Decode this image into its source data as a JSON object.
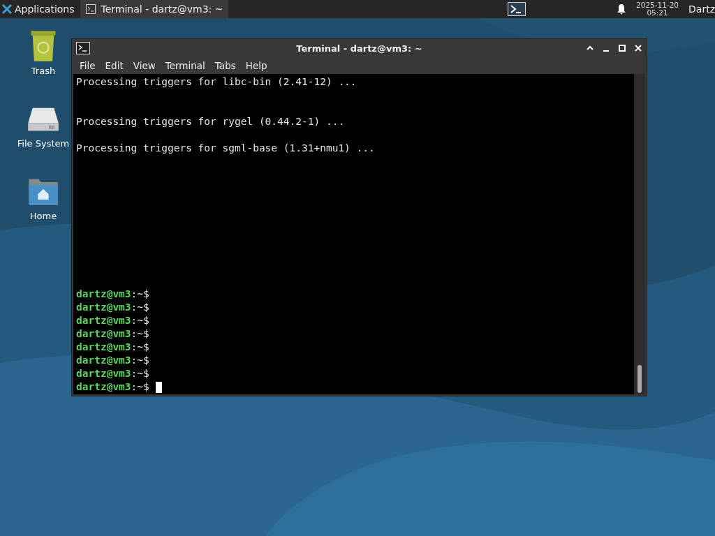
{
  "panel": {
    "apps_menu": "Applications",
    "tasks": [
      {
        "title": "Terminal - dartz@vm3: ~",
        "selected": true
      }
    ],
    "date": "2025-11-20",
    "time": "05:21",
    "user": "Dartz"
  },
  "desktop_icons": [
    {
      "label": "Trash",
      "kind": "trash"
    },
    {
      "label": "File System",
      "kind": "drive"
    },
    {
      "label": "Home",
      "kind": "home"
    }
  ],
  "window": {
    "title": "Terminal - dartz@vm3: ~",
    "menu": [
      "File",
      "Edit",
      "View",
      "Terminal",
      "Tabs",
      "Help"
    ],
    "lines": [
      {
        "kind": "output",
        "text": "Processing triggers for libc-bin (2.41-12) ..."
      },
      {
        "kind": "blank"
      },
      {
        "kind": "blank"
      },
      {
        "kind": "output",
        "text": "Processing triggers for rygel (0.44.2-1) ..."
      },
      {
        "kind": "blank"
      },
      {
        "kind": "output",
        "text": "Processing triggers for sgml-base (1.31+nmu1) ..."
      },
      {
        "kind": "blank"
      },
      {
        "kind": "blank"
      },
      {
        "kind": "blank"
      },
      {
        "kind": "blank"
      },
      {
        "kind": "blank"
      },
      {
        "kind": "blank"
      },
      {
        "kind": "blank"
      },
      {
        "kind": "blank"
      },
      {
        "kind": "blank"
      },
      {
        "kind": "blank"
      },
      {
        "kind": "prompt",
        "user": "dartz@vm3",
        "path": ":~$",
        "cursor": false
      },
      {
        "kind": "prompt",
        "user": "dartz@vm3",
        "path": ":~$",
        "cursor": false
      },
      {
        "kind": "prompt",
        "user": "dartz@vm3",
        "path": ":~$",
        "cursor": false
      },
      {
        "kind": "prompt",
        "user": "dartz@vm3",
        "path": ":~$",
        "cursor": false
      },
      {
        "kind": "prompt",
        "user": "dartz@vm3",
        "path": ":~$",
        "cursor": false
      },
      {
        "kind": "prompt",
        "user": "dartz@vm3",
        "path": ":~$",
        "cursor": false
      },
      {
        "kind": "prompt",
        "user": "dartz@vm3",
        "path": ":~$",
        "cursor": false
      },
      {
        "kind": "prompt",
        "user": "dartz@vm3",
        "path": ":~$",
        "cursor": true
      }
    ]
  }
}
